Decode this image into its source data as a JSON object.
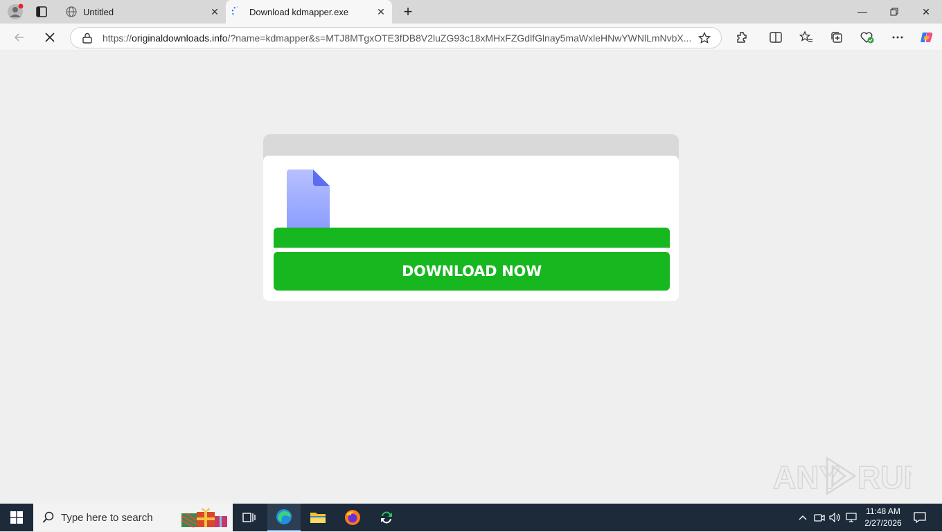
{
  "tabs": [
    {
      "title": "Untitled",
      "icon": "globe-icon",
      "active": false
    },
    {
      "title": "Download kdmapper.exe",
      "icon": "loading-spinner-icon",
      "active": true
    }
  ],
  "address": {
    "scheme": "https://",
    "host": "originaldownloads.info",
    "rest": "/?name=kdmapper&s=MTJ8MTgxOTE3fDB8V2luZG93c18xMHxFZGdlfGlnay5maWxleHNwYWNlLmNvbX..."
  },
  "page": {
    "button_label": "DOWNLOAD NOW",
    "progress": 1.0,
    "colors": {
      "accent": "#17b81f",
      "file_icon": "#9aa7ff"
    }
  },
  "watermark": {
    "text": "ANY RUN"
  },
  "taskbar": {
    "search_placeholder": "Type here to search",
    "time": "11:48 AM",
    "date": "2/27/2026"
  }
}
